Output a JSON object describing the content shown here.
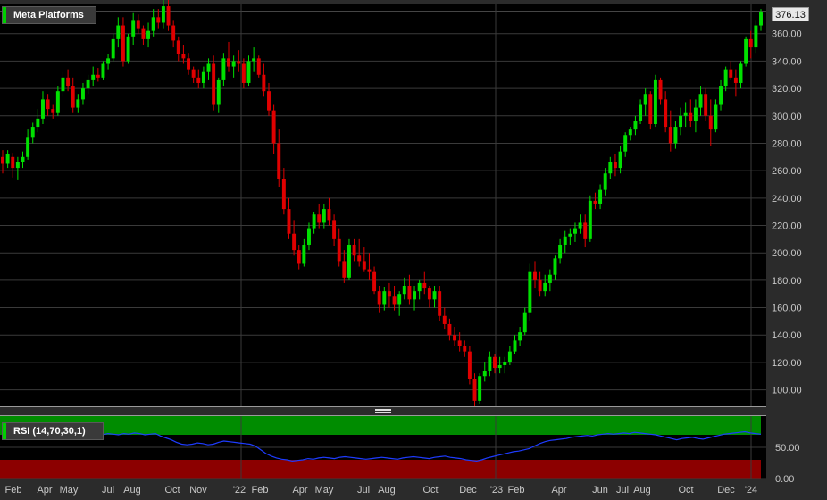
{
  "colors": {
    "background": "#000000",
    "grid": "#3a3a3a",
    "up": "#00e000",
    "down": "#e00000",
    "rsi_line": "#1e3cff",
    "rsi_overbought": "#008c00",
    "rsi_oversold": "#8c0000",
    "legend_swatch": "#00d000"
  },
  "price_legend": "Meta Platforms",
  "last_price_label": "376.13",
  "rsi_legend": "RSI (14,70,30,1)",
  "chart_data": [
    {
      "type": "candlestick",
      "title": "Meta Platforms",
      "ylim": [
        88,
        382
      ],
      "y_ticks": [
        "100.00",
        "120.00",
        "140.00",
        "160.00",
        "180.00",
        "200.00",
        "220.00",
        "240.00",
        "260.00",
        "280.00",
        "300.00",
        "320.00",
        "340.00",
        "360.00"
      ],
      "last_price": 376.13,
      "grid": true,
      "weekly_candles": [
        [
          270,
          275,
          258,
          265
        ],
        [
          265,
          275,
          262,
          272
        ],
        [
          270,
          273,
          255,
          262
        ],
        [
          262,
          270,
          253,
          266
        ],
        [
          266,
          274,
          262,
          270
        ],
        [
          270,
          290,
          268,
          284
        ],
        [
          284,
          295,
          280,
          292
        ],
        [
          292,
          305,
          288,
          298
        ],
        [
          298,
          318,
          294,
          312
        ],
        [
          312,
          316,
          300,
          305
        ],
        [
          305,
          308,
          298,
          302
        ],
        [
          302,
          322,
          300,
          318
        ],
        [
          318,
          332,
          314,
          328
        ],
        [
          328,
          334,
          318,
          322
        ],
        [
          322,
          328,
          302,
          306
        ],
        [
          306,
          316,
          302,
          312
        ],
        [
          312,
          324,
          308,
          320
        ],
        [
          320,
          330,
          316,
          326
        ],
        [
          326,
          336,
          322,
          330
        ],
        [
          330,
          335,
          325,
          328
        ],
        [
          328,
          340,
          326,
          338
        ],
        [
          338,
          345,
          334,
          342
        ],
        [
          342,
          360,
          340,
          356
        ],
        [
          356,
          372,
          350,
          366
        ],
        [
          366,
          372,
          336,
          340
        ],
        [
          340,
          360,
          338,
          358
        ],
        [
          358,
          375,
          352,
          370
        ],
        [
          370,
          374,
          360,
          364
        ],
        [
          364,
          366,
          352,
          356
        ],
        [
          356,
          368,
          350,
          362
        ],
        [
          362,
          378,
          358,
          372
        ],
        [
          372,
          378,
          364,
          368
        ],
        [
          368,
          385,
          364,
          380
        ],
        [
          380,
          386,
          362,
          366
        ],
        [
          366,
          370,
          350,
          355
        ],
        [
          355,
          358,
          340,
          345
        ],
        [
          345,
          352,
          338,
          342
        ],
        [
          342,
          346,
          330,
          334
        ],
        [
          334,
          336,
          324,
          328
        ],
        [
          328,
          334,
          320,
          324
        ],
        [
          324,
          336,
          320,
          332
        ],
        [
          332,
          342,
          326,
          338
        ],
        [
          338,
          344,
          304,
          308
        ],
        [
          308,
          328,
          302,
          326
        ],
        [
          326,
          346,
          322,
          342
        ],
        [
          342,
          354,
          332,
          336
        ],
        [
          336,
          344,
          328,
          340
        ],
        [
          340,
          348,
          332,
          338
        ],
        [
          338,
          342,
          320,
          324
        ],
        [
          324,
          344,
          322,
          340
        ],
        [
          340,
          350,
          332,
          342
        ],
        [
          342,
          344,
          328,
          330
        ],
        [
          330,
          338,
          314,
          318
        ],
        [
          318,
          324,
          300,
          304
        ],
        [
          304,
          308,
          272,
          280
        ],
        [
          280,
          290,
          248,
          254
        ],
        [
          254,
          262,
          228,
          232
        ],
        [
          232,
          240,
          210,
          214
        ],
        [
          214,
          224,
          198,
          202
        ],
        [
          202,
          206,
          188,
          192
        ],
        [
          192,
          210,
          190,
          206
        ],
        [
          206,
          222,
          202,
          218
        ],
        [
          218,
          230,
          214,
          228
        ],
        [
          228,
          236,
          218,
          222
        ],
        [
          222,
          236,
          218,
          232
        ],
        [
          232,
          240,
          220,
          224
        ],
        [
          224,
          228,
          205,
          210
        ],
        [
          210,
          218,
          190,
          194
        ],
        [
          194,
          202,
          178,
          182
        ],
        [
          182,
          210,
          180,
          206
        ],
        [
          206,
          210,
          194,
          198
        ],
        [
          198,
          210,
          190,
          194
        ],
        [
          194,
          204,
          186,
          188
        ],
        [
          188,
          200,
          180,
          186
        ],
        [
          186,
          190,
          170,
          172
        ],
        [
          172,
          176,
          156,
          162
        ],
        [
          162,
          175,
          158,
          172
        ],
        [
          172,
          178,
          160,
          168
        ],
        [
          168,
          176,
          158,
          162
        ],
        [
          162,
          172,
          154,
          170
        ],
        [
          170,
          182,
          166,
          176
        ],
        [
          176,
          184,
          162,
          166
        ],
        [
          166,
          176,
          158,
          172
        ],
        [
          172,
          180,
          166,
          178
        ],
        [
          178,
          186,
          170,
          174
        ],
        [
          174,
          176,
          160,
          166
        ],
        [
          166,
          176,
          160,
          172
        ],
        [
          172,
          176,
          150,
          154
        ],
        [
          154,
          160,
          144,
          148
        ],
        [
          148,
          152,
          136,
          140
        ],
        [
          140,
          146,
          132,
          136
        ],
        [
          136,
          142,
          128,
          132
        ],
        [
          132,
          136,
          124,
          128
        ],
        [
          128,
          132,
          104,
          108
        ],
        [
          108,
          112,
          88,
          92
        ],
        [
          92,
          112,
          90,
          110
        ],
        [
          110,
          120,
          106,
          114
        ],
        [
          114,
          128,
          110,
          124
        ],
        [
          124,
          126,
          112,
          116
        ],
        [
          116,
          124,
          112,
          118
        ],
        [
          118,
          124,
          112,
          120
        ],
        [
          120,
          132,
          118,
          128
        ],
        [
          128,
          140,
          126,
          136
        ],
        [
          136,
          146,
          132,
          142
        ],
        [
          142,
          160,
          140,
          156
        ],
        [
          156,
          192,
          150,
          186
        ],
        [
          186,
          194,
          174,
          180
        ],
        [
          180,
          186,
          168,
          172
        ],
        [
          172,
          184,
          168,
          178
        ],
        [
          178,
          188,
          172,
          184
        ],
        [
          184,
          198,
          180,
          196
        ],
        [
          196,
          210,
          192,
          206
        ],
        [
          206,
          216,
          200,
          212
        ],
        [
          212,
          218,
          206,
          214
        ],
        [
          214,
          222,
          208,
          218
        ],
        [
          218,
          228,
          214,
          222
        ],
        [
          222,
          228,
          204,
          210
        ],
        [
          210,
          242,
          208,
          238
        ],
        [
          238,
          244,
          232,
          236
        ],
        [
          236,
          250,
          232,
          246
        ],
        [
          246,
          262,
          242,
          258
        ],
        [
          258,
          270,
          254,
          266
        ],
        [
          266,
          272,
          256,
          262
        ],
        [
          262,
          278,
          258,
          274
        ],
        [
          274,
          288,
          270,
          286
        ],
        [
          286,
          292,
          282,
          290
        ],
        [
          290,
          300,
          286,
          296
        ],
        [
          296,
          312,
          294,
          308
        ],
        [
          308,
          320,
          300,
          316
        ],
        [
          316,
          318,
          290,
          294
        ],
        [
          294,
          330,
          292,
          326
        ],
        [
          326,
          328,
          308,
          312
        ],
        [
          312,
          318,
          288,
          292
        ],
        [
          292,
          304,
          274,
          280
        ],
        [
          280,
          296,
          276,
          292
        ],
        [
          292,
          306,
          286,
          300
        ],
        [
          300,
          310,
          292,
          302
        ],
        [
          302,
          312,
          292,
          296
        ],
        [
          296,
          312,
          288,
          306
        ],
        [
          306,
          322,
          300,
          316
        ],
        [
          316,
          320,
          296,
          300
        ],
        [
          300,
          312,
          278,
          290
        ],
        [
          290,
          312,
          288,
          308
        ],
        [
          308,
          326,
          304,
          322
        ],
        [
          322,
          336,
          318,
          334
        ],
        [
          334,
          340,
          326,
          328
        ],
        [
          328,
          334,
          314,
          324
        ],
        [
          324,
          340,
          320,
          338
        ],
        [
          338,
          358,
          336,
          356
        ],
        [
          356,
          362,
          342,
          350
        ],
        [
          350,
          370,
          346,
          366
        ],
        [
          366,
          378,
          362,
          376
        ]
      ]
    },
    {
      "type": "line",
      "title": "RSI (14,70,30,1)",
      "ylim": [
        0,
        100
      ],
      "y_ticks": [
        "50.00",
        "0.00"
      ],
      "overbought": 70,
      "oversold": 30,
      "series": [
        {
          "values": [
            70,
            71,
            69,
            70,
            72,
            74,
            71,
            70,
            73,
            74,
            70,
            69,
            72,
            71,
            70,
            72,
            70,
            68,
            69,
            70,
            72,
            71,
            70,
            72,
            71,
            73,
            72,
            70,
            71,
            72,
            68,
            65,
            62,
            58,
            55,
            54,
            55,
            57,
            56,
            54,
            55,
            58,
            60,
            59,
            58,
            57,
            56,
            55,
            52,
            46,
            40,
            36,
            33,
            31,
            30,
            28,
            29,
            30,
            32,
            31,
            33,
            34,
            33,
            32,
            34,
            35,
            34,
            33,
            32,
            31,
            32,
            33,
            34,
            33,
            32,
            31,
            33,
            34,
            35,
            34,
            33,
            32,
            34,
            35,
            36,
            34,
            33,
            32,
            30,
            29,
            28,
            30,
            33,
            35,
            37,
            39,
            41,
            43,
            44,
            46,
            48,
            52,
            56,
            59,
            61,
            62,
            63,
            64,
            66,
            67,
            68,
            69,
            68,
            70,
            71,
            72,
            71,
            72,
            73,
            72,
            74,
            73,
            72,
            71,
            70,
            68,
            66,
            64,
            62,
            64,
            65,
            66,
            64,
            63,
            65,
            67,
            69,
            71,
            72,
            73,
            74,
            75,
            73,
            72,
            71
          ]
        }
      ]
    }
  ],
  "x_ticks": [
    "Feb",
    "Apr",
    "May",
    "Jul",
    "Aug",
    "Oct",
    "Nov",
    "'22",
    "Feb",
    "Apr",
    "May",
    "Jul",
    "Aug",
    "Oct",
    "Dec",
    "'23",
    "Feb",
    "Apr",
    "Jun",
    "Jul",
    "Aug",
    "Oct",
    "Dec",
    "'24"
  ]
}
